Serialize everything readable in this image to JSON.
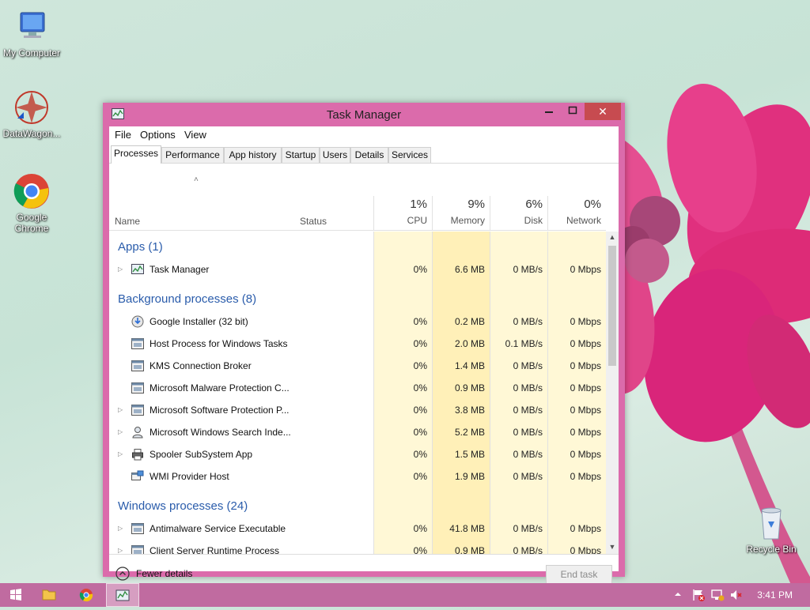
{
  "desktop": {
    "icons": [
      {
        "label": "My Computer"
      },
      {
        "label": "DataWagon..."
      },
      {
        "label": "Google Chrome"
      },
      {
        "label": "Recycle Bin"
      }
    ]
  },
  "window": {
    "title": "Task Manager",
    "close_glyph": "✕",
    "menu": [
      "File",
      "Options",
      "View"
    ],
    "tabs": [
      "Processes",
      "Performance",
      "App history",
      "Startup",
      "Users",
      "Details",
      "Services"
    ],
    "active_tab": "Processes",
    "columns": {
      "name": "Name",
      "status": "Status",
      "cpu": {
        "pct": "1%",
        "label": "CPU"
      },
      "memory": {
        "pct": "9%",
        "label": "Memory"
      },
      "disk": {
        "pct": "6%",
        "label": "Disk"
      },
      "network": {
        "pct": "0%",
        "label": "Network"
      }
    },
    "groups": {
      "apps": "Apps (1)",
      "background": "Background processes (8)",
      "windows": "Windows processes (24)"
    },
    "processes": [
      {
        "name": "Task Manager",
        "cpu": "0%",
        "mem": "6.6 MB",
        "disk": "0 MB/s",
        "net": "0 Mbps",
        "expandable": true,
        "icon": "taskmanager-icon"
      },
      {
        "name": "Google Installer (32 bit)",
        "cpu": "0%",
        "mem": "0.2 MB",
        "disk": "0 MB/s",
        "net": "0 Mbps",
        "expandable": false,
        "icon": "installer-icon"
      },
      {
        "name": "Host Process for Windows Tasks",
        "cpu": "0%",
        "mem": "2.0 MB",
        "disk": "0.1 MB/s",
        "net": "0 Mbps",
        "expandable": false,
        "icon": "process-icon"
      },
      {
        "name": "KMS Connection Broker",
        "cpu": "0%",
        "mem": "1.4 MB",
        "disk": "0 MB/s",
        "net": "0 Mbps",
        "expandable": false,
        "icon": "process-icon"
      },
      {
        "name": "Microsoft Malware Protection C...",
        "cpu": "0%",
        "mem": "0.9 MB",
        "disk": "0 MB/s",
        "net": "0 Mbps",
        "expandable": false,
        "icon": "process-icon"
      },
      {
        "name": "Microsoft Software Protection P...",
        "cpu": "0%",
        "mem": "3.8 MB",
        "disk": "0 MB/s",
        "net": "0 Mbps",
        "expandable": true,
        "icon": "process-icon"
      },
      {
        "name": "Microsoft Windows Search Inde...",
        "cpu": "0%",
        "mem": "5.2 MB",
        "disk": "0 MB/s",
        "net": "0 Mbps",
        "expandable": true,
        "icon": "search-user-icon"
      },
      {
        "name": "Spooler SubSystem App",
        "cpu": "0%",
        "mem": "1.5 MB",
        "disk": "0 MB/s",
        "net": "0 Mbps",
        "expandable": true,
        "icon": "printer-icon"
      },
      {
        "name": "WMI Provider Host",
        "cpu": "0%",
        "mem": "1.9 MB",
        "disk": "0 MB/s",
        "net": "0 Mbps",
        "expandable": false,
        "icon": "wmi-icon"
      },
      {
        "name": "Antimalware Service Executable",
        "cpu": "0%",
        "mem": "41.8 MB",
        "disk": "0 MB/s",
        "net": "0 Mbps",
        "expandable": true,
        "icon": "process-icon"
      },
      {
        "name": "Client Server Runtime Process",
        "cpu": "0%",
        "mem": "0.9 MB",
        "disk": "0 MB/s",
        "net": "0 Mbps",
        "expandable": true,
        "icon": "process-icon"
      }
    ],
    "footer": {
      "fewer_details": "Fewer details",
      "end_task": "End task"
    }
  },
  "taskbar": {
    "clock": "3:41 PM"
  }
}
